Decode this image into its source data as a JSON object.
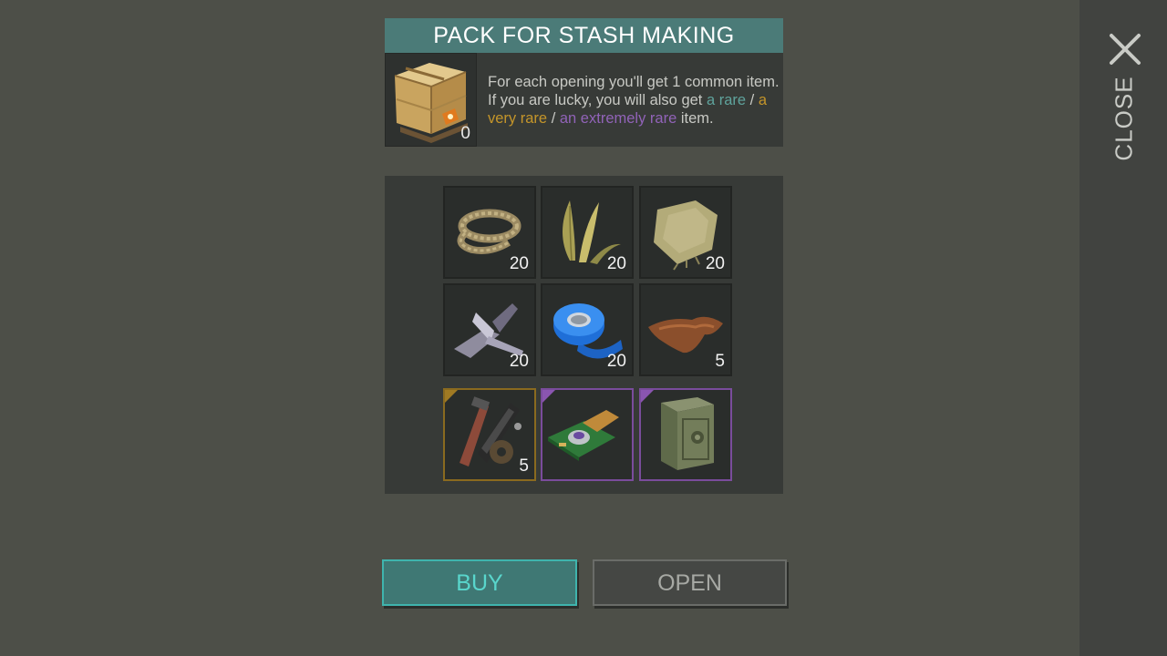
{
  "pack": {
    "title": "PACK FOR STASH MAKING",
    "crate_icon": "furniture-crate-icon",
    "crate_count": "0",
    "description": {
      "part1": "For each opening you'll get 1 common item. If you are lucky, you will also get ",
      "rare": "a rare",
      "sep1": " / ",
      "very_rare": "a very rare",
      "sep2": " / ",
      "extremely_rare": "an extremely rare",
      "part2": " item."
    }
  },
  "items": [
    {
      "icon": "rope-icon",
      "count": "20"
    },
    {
      "icon": "plant-fiber-icon",
      "count": "20"
    },
    {
      "icon": "cloth-icon",
      "count": "20"
    },
    {
      "icon": "scrap-metal-icon",
      "count": "20"
    },
    {
      "icon": "duct-tape-icon",
      "count": "20"
    },
    {
      "icon": "leather-icon",
      "count": "5"
    },
    {
      "icon": "spare-parts-icon",
      "count": "5",
      "rarity": "very-rare"
    },
    {
      "icon": "circuit-board-icon",
      "count": "",
      "rarity": "extremely-rare"
    },
    {
      "icon": "safe-icon",
      "count": "",
      "rarity": "extremely-rare"
    }
  ],
  "buttons": {
    "buy": "BUY",
    "open": "OPEN"
  },
  "close": {
    "label": "CLOSE",
    "icon": "close-icon"
  },
  "colors": {
    "rare": "#5fa39c",
    "very_rare": "#c4952a",
    "extremely_rare": "#9163b8",
    "accent": "#3fb4ad"
  }
}
